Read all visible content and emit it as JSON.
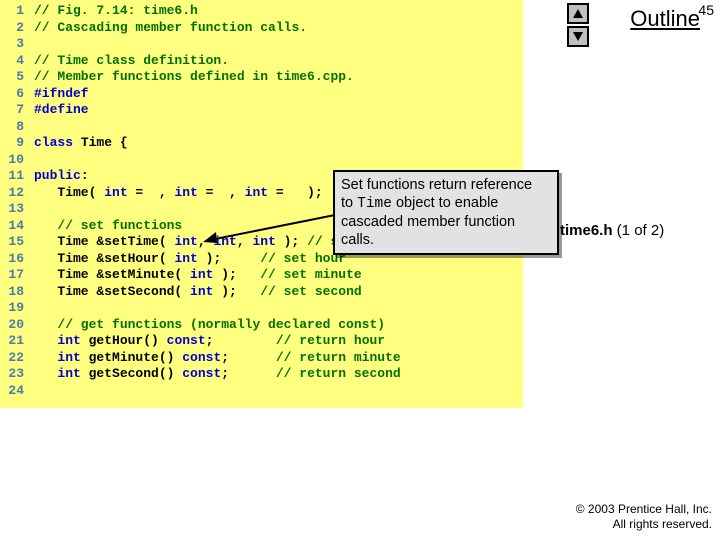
{
  "pagenum": "45",
  "outline": "Outline",
  "side_caption_a": "time6.h",
  "side_caption_b": " (1 of 2)",
  "callout": {
    "l1": "Set functions return reference",
    "l2a": "to ",
    "l2b": "Time",
    "l2c": " object to enable",
    "l3": "cascaded member function",
    "l4": "calls."
  },
  "code": {
    "l1": {
      "n": "1",
      "c": "// Fig. 7.14: time6.h"
    },
    "l2": {
      "n": "2",
      "c": "// Cascading member function calls."
    },
    "l3": {
      "n": "3",
      "c": ""
    },
    "l4": {
      "n": "4",
      "c": "// Time class definition."
    },
    "l5": {
      "n": "5",
      "c": "// Member functions defined in time6.cpp."
    },
    "l6": {
      "n": "6",
      "k": "#ifndef"
    },
    "l7": {
      "n": "7",
      "k": "#define"
    },
    "l8": {
      "n": "8",
      "c": ""
    },
    "l9": {
      "n": "9",
      "k1": "class ",
      "t1": "Time {"
    },
    "l10": {
      "n": "10",
      "c": ""
    },
    "l11": {
      "n": "11",
      "k1": "public",
      "t1": ":"
    },
    "l12": {
      "n": "12",
      "t1": "   Time( ",
      "k1": "int",
      "t2": " =  , ",
      "k2": "int",
      "t3": " =  , ",
      "k3": "int",
      "t4": " =   );"
    },
    "l13": {
      "n": "13",
      "c": ""
    },
    "l14": {
      "n": "14",
      "t1": "   ",
      "c": "// set functions"
    },
    "l15": {
      "n": "15",
      "t1": "   Time &setTime( ",
      "k1": "int",
      "t2": ", ",
      "k2": "int",
      "t3": ", ",
      "k3": "int",
      "t4": " ); ",
      "c": "// set hour, minute, second"
    },
    "l16": {
      "n": "16",
      "t1": "   Time &setHour( ",
      "k1": "int",
      "t2": " );     ",
      "c": "// set hour"
    },
    "l17": {
      "n": "17",
      "t1": "   Time &setMinute( ",
      "k1": "int",
      "t2": " );   ",
      "c": "// set minute"
    },
    "l18": {
      "n": "18",
      "t1": "   Time &setSecond( ",
      "k1": "int",
      "t2": " );   ",
      "c": "// set second"
    },
    "l19": {
      "n": "19",
      "c": ""
    },
    "l20": {
      "n": "20",
      "t1": "   ",
      "c": "// get functions (normally declared const)"
    },
    "l21": {
      "n": "21",
      "k1": "   int",
      "t1": " getHour() ",
      "k2": "const",
      "t2": ";        ",
      "c": "// return hour"
    },
    "l22": {
      "n": "22",
      "k1": "   int",
      "t1": " getMinute() ",
      "k2": "const",
      "t2": ";      ",
      "c": "// return minute"
    },
    "l23": {
      "n": "23",
      "k1": "   int",
      "t1": " getSecond() ",
      "k2": "const",
      "t2": ";      ",
      "c": "// return second"
    },
    "l24": {
      "n": "24",
      "c": ""
    }
  },
  "copyright": {
    "l1": "© 2003 Prentice Hall, Inc.",
    "l2": "All rights reserved."
  }
}
